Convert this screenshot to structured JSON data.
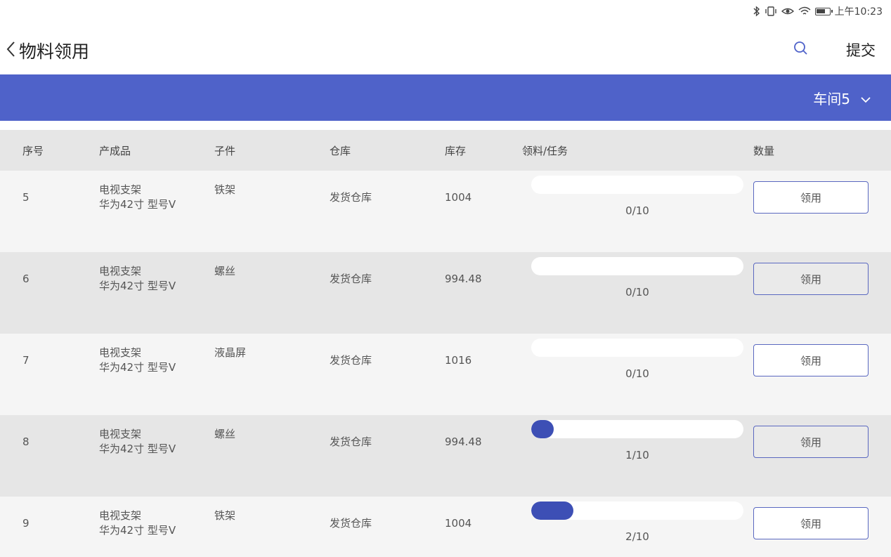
{
  "status": {
    "time": "上午10:23"
  },
  "header": {
    "title": "物料领用",
    "submit_label": "提交"
  },
  "toolbar": {
    "workshop": "车间5"
  },
  "table": {
    "headers": [
      "序号",
      "产成品",
      "子件",
      "仓库",
      "库存",
      "领料/任务",
      "数量"
    ],
    "rows": [
      {
        "no": "5",
        "product_line1": "电视支架",
        "product_line2": "华为42寸 型号V",
        "part": "铁架",
        "warehouse": "发货仓库",
        "stock": "1004",
        "progress": 0.0,
        "ratio": "0/10",
        "action": "领用"
      },
      {
        "no": "6",
        "product_line1": "电视支架",
        "product_line2": "华为42寸 型号V",
        "part": "螺丝",
        "warehouse": "发货仓库",
        "stock": "994.48",
        "progress": 0.0,
        "ratio": "0/10",
        "action": "领用"
      },
      {
        "no": "7",
        "product_line1": "电视支架",
        "product_line2": "华为42寸 型号V",
        "part": "液晶屏",
        "warehouse": "发货仓库",
        "stock": "1016",
        "progress": 0.0,
        "ratio": "0/10",
        "action": "领用"
      },
      {
        "no": "8",
        "product_line1": "电视支架",
        "product_line2": "华为42寸 型号V",
        "part": "螺丝",
        "warehouse": "发货仓库",
        "stock": "994.48",
        "progress": 0.1,
        "ratio": "1/10",
        "action": "领用"
      },
      {
        "no": "9",
        "product_line1": "电视支架",
        "product_line2": "华为42寸 型号V",
        "part": "铁架",
        "warehouse": "发货仓库",
        "stock": "1004",
        "progress": 0.2,
        "ratio": "2/10",
        "action": "领用"
      }
    ]
  },
  "colors": {
    "accent": "#4f62c9",
    "progress": "#3d4fb5",
    "row_light": "#f5f5f5",
    "row_dark": "#e6e6e6"
  },
  "icons": [
    "bluetooth-icon",
    "vibrate-icon",
    "eye-icon",
    "wifi-icon",
    "battery-icon",
    "back-arrow-icon",
    "search-icon",
    "chevron-down-icon"
  ]
}
